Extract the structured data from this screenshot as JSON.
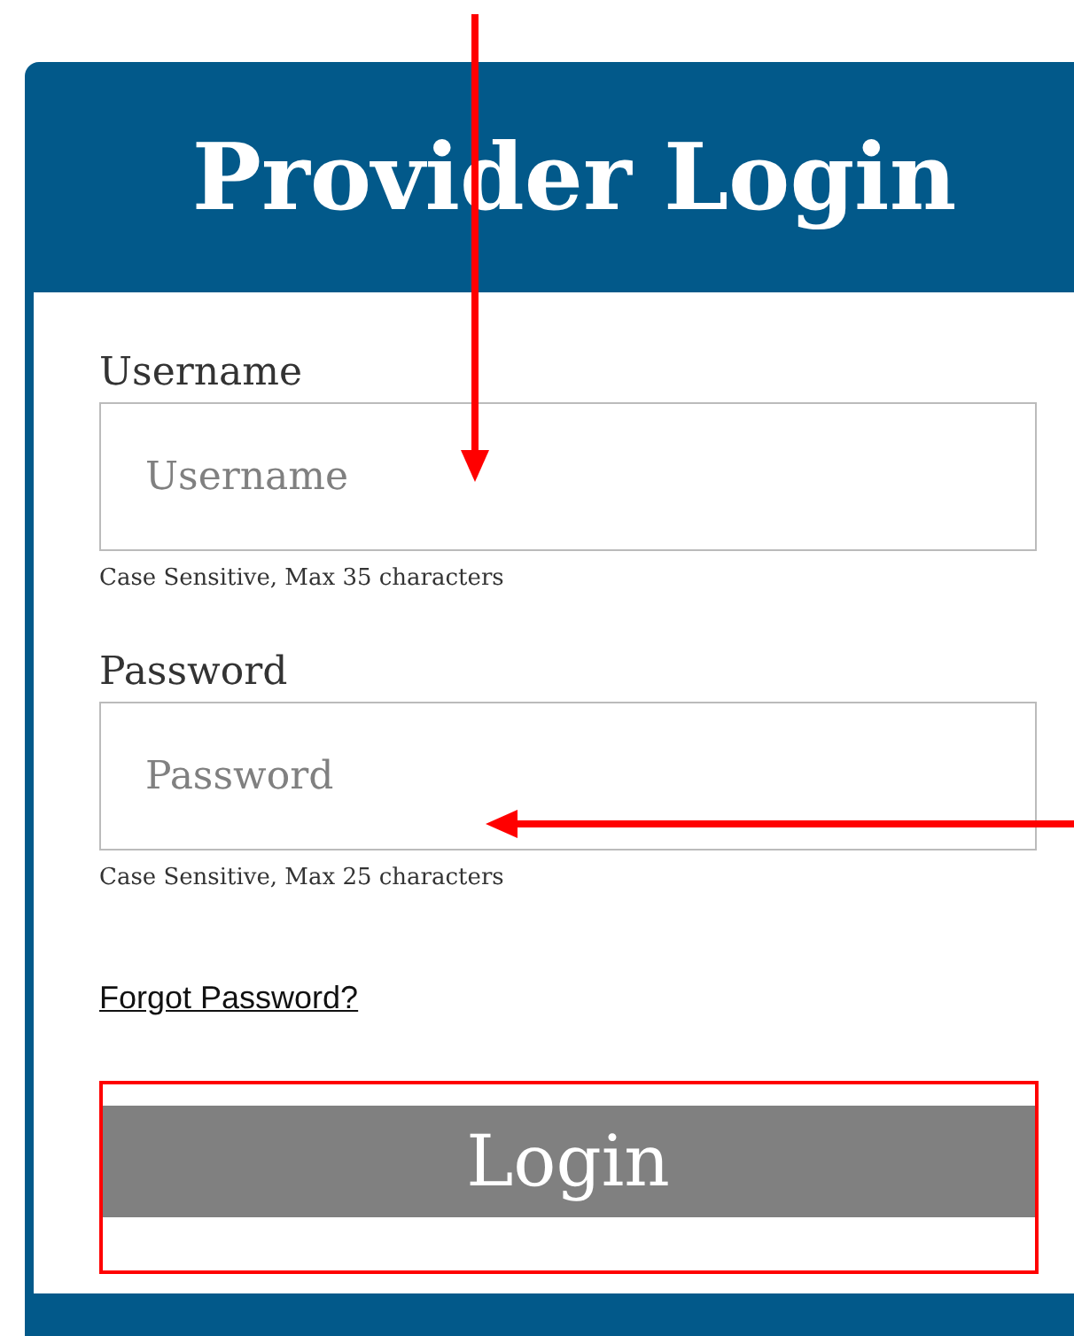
{
  "header": {
    "title": "Provider Login"
  },
  "fields": [
    {
      "label": "Username",
      "placeholder": "Username",
      "hint": "Case Sensitive, Max 35 characters"
    },
    {
      "label": "Password",
      "placeholder": "Password",
      "hint": "Case Sensitive, Max 25 characters"
    }
  ],
  "forgot_link": "Forgot Password?",
  "login_button": "Login"
}
